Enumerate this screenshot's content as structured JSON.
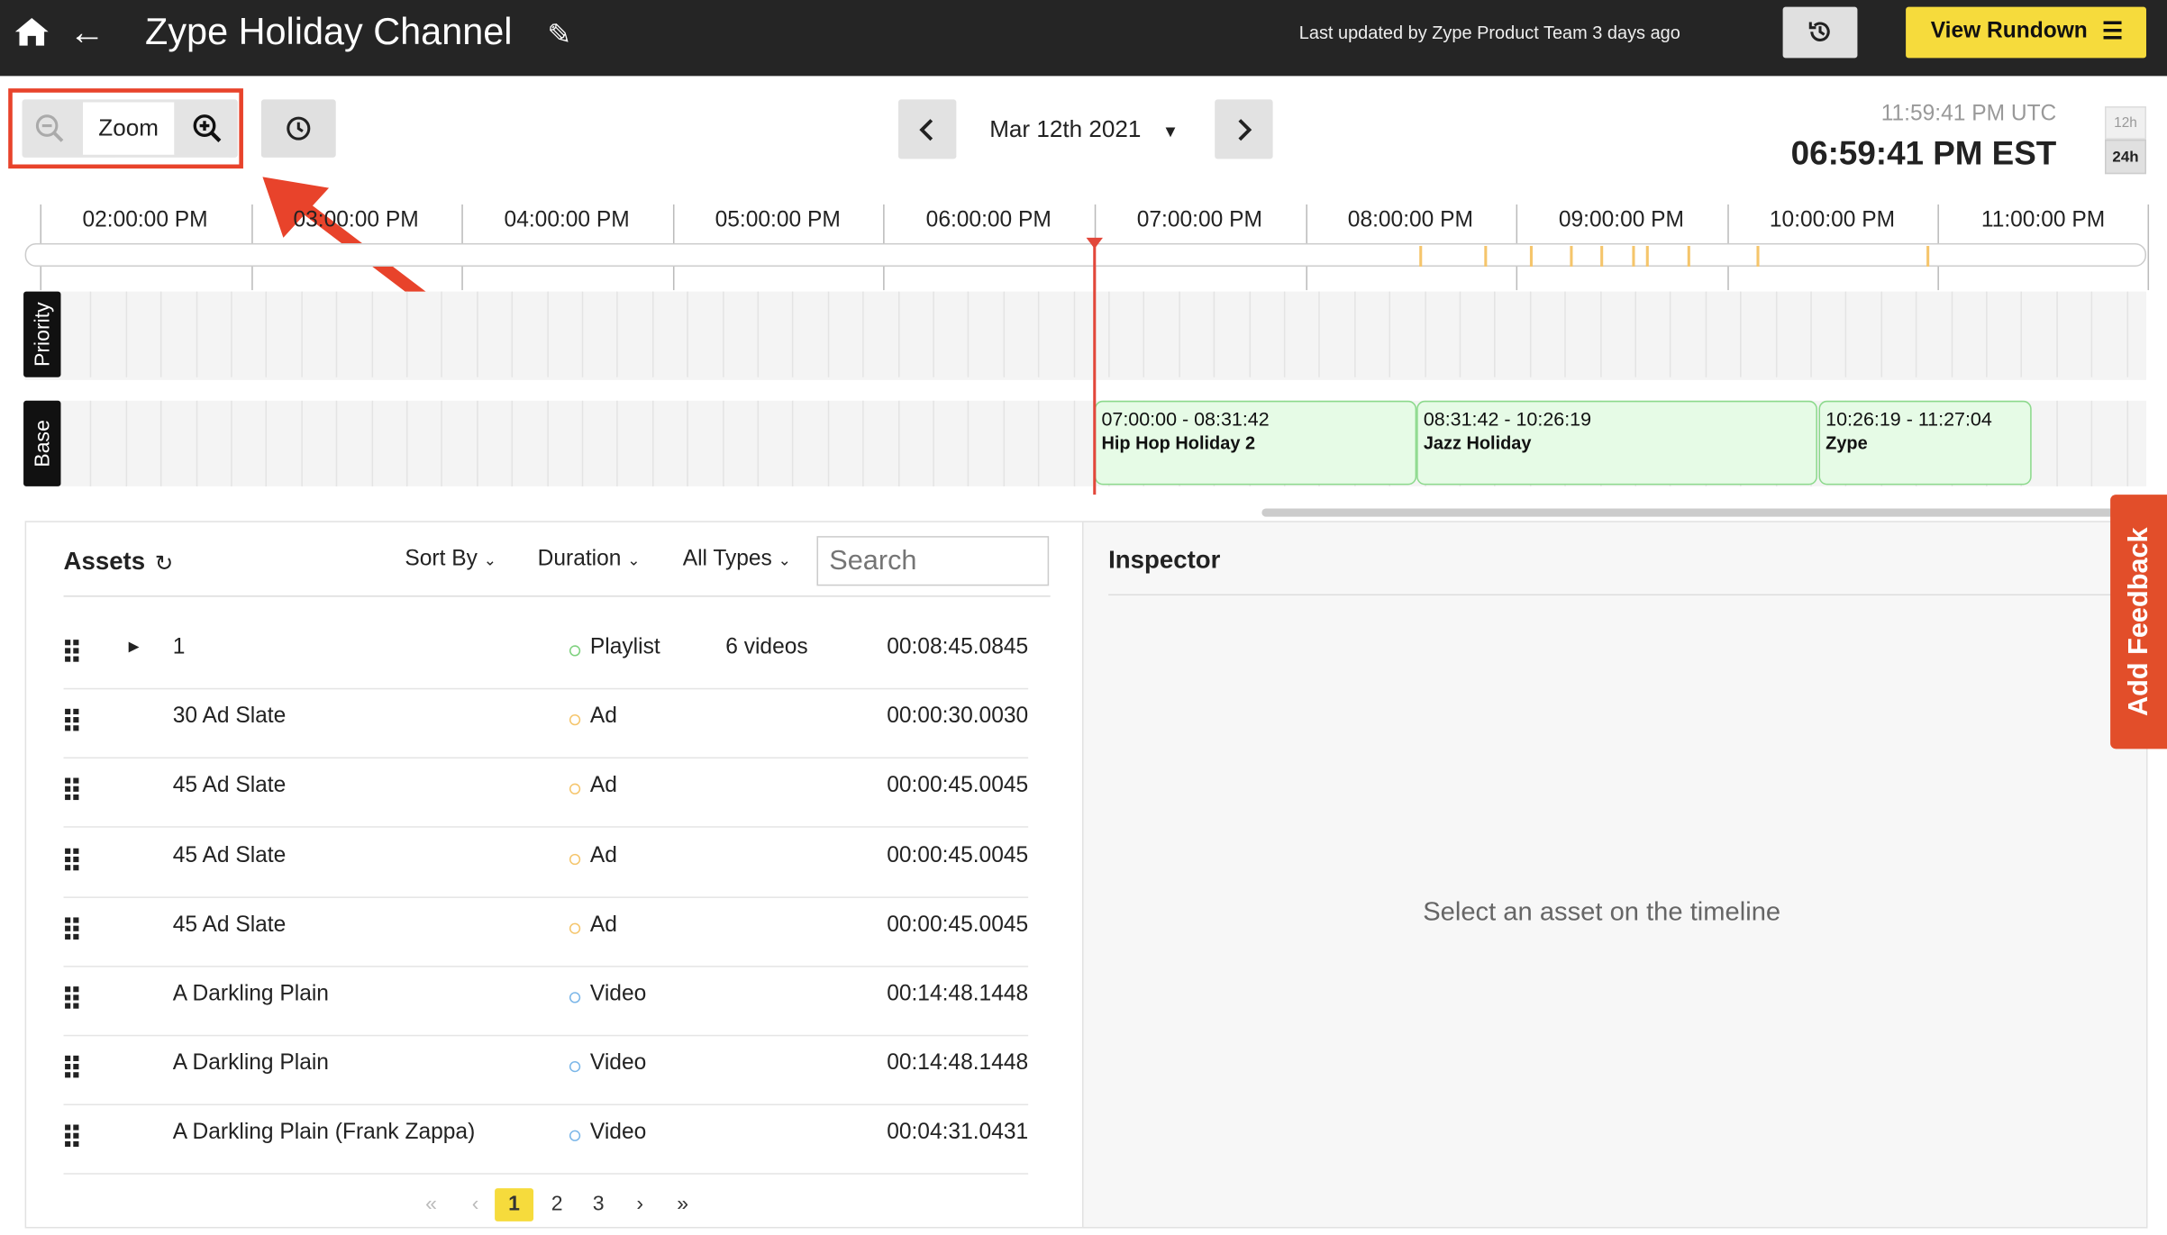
{
  "header": {
    "title": "Zype Holiday Channel",
    "updated": "Last updated by Zype Product Team 3 days ago",
    "view_rundown": "View Rundown",
    "menu_icon": "☰"
  },
  "toolbar": {
    "zoom_label": "Zoom",
    "date": "Mar 12th 2021",
    "utc_time": "11:59:41 PM UTC",
    "est_time": "06:59:41 PM EST",
    "btn_12h": "12h",
    "btn_24h": "24h"
  },
  "timeline": {
    "ticks": [
      "02:00:00 PM",
      "03:00:00 PM",
      "04:00:00 PM",
      "05:00:00 PM",
      "06:00:00 PM",
      "07:00:00 PM",
      "08:00:00 PM",
      "09:00:00 PM",
      "10:00:00 PM",
      "11:00:00 PM"
    ],
    "lanes": {
      "priority": "Priority",
      "base": "Base"
    },
    "blocks": [
      {
        "time": "07:00:00 - 08:31:42",
        "name": "Hip Hop Holiday 2"
      },
      {
        "time": "08:31:42 - 10:26:19",
        "name": "Jazz Holiday"
      },
      {
        "time": "10:26:19 - 11:27:04",
        "name": "Zype"
      }
    ]
  },
  "assets": {
    "title": "Assets",
    "filters": {
      "sort": "Sort By",
      "duration": "Duration",
      "types": "All Types"
    },
    "search_placeholder": "Search",
    "rows": [
      {
        "name": "1",
        "type": "Playlist",
        "count": "6 videos",
        "duration": "00:08:45.0845",
        "color": "#7ed17e"
      },
      {
        "name": "30 Ad Slate",
        "type": "Ad",
        "count": "",
        "duration": "00:00:30.0030",
        "color": "#f5c56b"
      },
      {
        "name": "45 Ad Slate",
        "type": "Ad",
        "count": "",
        "duration": "00:00:45.0045",
        "color": "#f5c56b"
      },
      {
        "name": "45 Ad Slate",
        "type": "Ad",
        "count": "",
        "duration": "00:00:45.0045",
        "color": "#f5c56b"
      },
      {
        "name": "45 Ad Slate",
        "type": "Ad",
        "count": "",
        "duration": "00:00:45.0045",
        "color": "#f5c56b"
      },
      {
        "name": "A Darkling Plain",
        "type": "Video",
        "count": "",
        "duration": "00:14:48.1448",
        "color": "#7ab6e8"
      },
      {
        "name": "A Darkling Plain",
        "type": "Video",
        "count": "",
        "duration": "00:14:48.1448",
        "color": "#7ab6e8"
      },
      {
        "name": "A Darkling Plain (Frank Zappa)",
        "type": "Video",
        "count": "",
        "duration": "00:04:31.0431",
        "color": "#7ab6e8"
      }
    ],
    "pagination": {
      "first": "«",
      "prev": "‹",
      "pages": [
        "1",
        "2",
        "3"
      ],
      "next": "›",
      "last": "»"
    }
  },
  "inspector": {
    "title": "Inspector",
    "empty": "Select an asset on the timeline"
  },
  "feedback": "Add Feedback",
  "colors": {
    "accent": "#f6db3c",
    "highlight": "#e8432b",
    "now_line": "#e2473a"
  }
}
